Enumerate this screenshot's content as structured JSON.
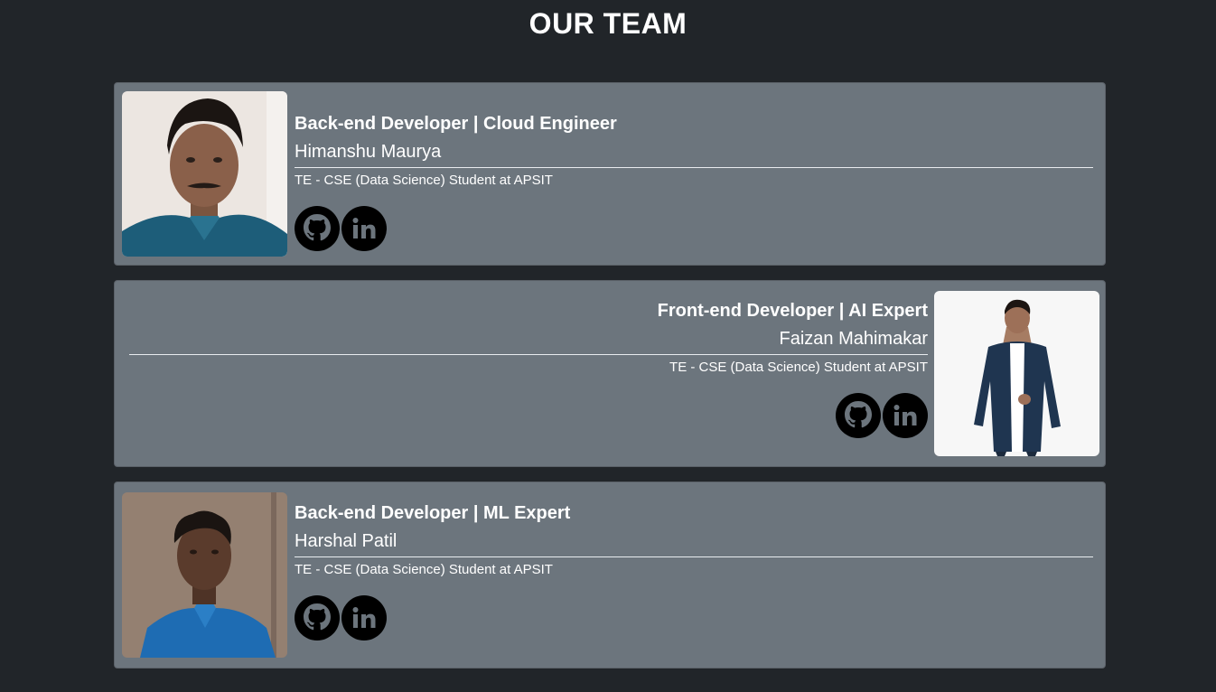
{
  "page": {
    "title": "OUR TEAM"
  },
  "colors": {
    "background": "#212529",
    "card": "#6c757d",
    "text": "#ffffff",
    "icon_bg": "#000000"
  },
  "members": [
    {
      "role": "Back-end Developer | Cloud Engineer",
      "name": "Himanshu Maurya",
      "education": "TE - CSE (Data Science) Student at APSIT",
      "photo_side": "left",
      "links": [
        {
          "icon": "github-icon"
        },
        {
          "icon": "linkedin-icon"
        }
      ]
    },
    {
      "role": "Front-end Developer | AI Expert",
      "name": "Faizan Mahimakar",
      "education": "TE - CSE (Data Science) Student at APSIT",
      "photo_side": "right",
      "links": [
        {
          "icon": "github-icon"
        },
        {
          "icon": "linkedin-icon"
        }
      ]
    },
    {
      "role": "Back-end Developer | ML Expert",
      "name": "Harshal Patil",
      "education": "TE - CSE (Data Science) Student at APSIT",
      "photo_side": "left",
      "links": [
        {
          "icon": "github-icon"
        },
        {
          "icon": "linkedin-icon"
        }
      ]
    }
  ]
}
